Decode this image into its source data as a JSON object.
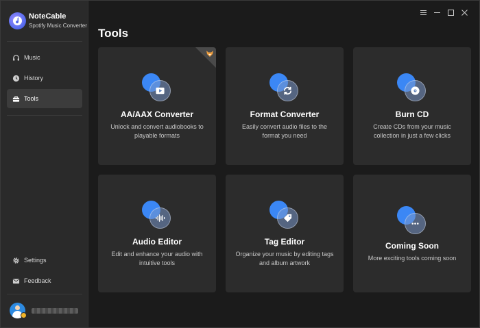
{
  "app": {
    "name": "NoteCable",
    "subtitle": "Spotify Music Converter"
  },
  "sidebar": {
    "items": [
      {
        "label": "Music",
        "icon": "headphones-icon",
        "active": false
      },
      {
        "label": "History",
        "icon": "clock-icon",
        "active": false
      },
      {
        "label": "Tools",
        "icon": "toolbox-icon",
        "active": true
      }
    ],
    "bottom_items": [
      {
        "label": "Settings",
        "icon": "gear-icon"
      },
      {
        "label": "Feedback",
        "icon": "mail-icon"
      }
    ]
  },
  "page": {
    "title": "Tools"
  },
  "tools": [
    {
      "title": "AA/AAX Converter",
      "description": "Unlock and convert audiobooks to playable formats",
      "icon": "play-icon",
      "badge": "fox-icon"
    },
    {
      "title": "Format Converter",
      "description": "Easily convert audio files to the format you need",
      "icon": "refresh-icon"
    },
    {
      "title": "Burn CD",
      "description": "Create CDs from your music collection in just a few clicks",
      "icon": "disc-icon"
    },
    {
      "title": "Audio Editor",
      "description": "Edit and enhance your audio with intuitive tools",
      "icon": "waveform-icon"
    },
    {
      "title": "Tag Editor",
      "description": "Organize your music by editing tags and album artwork",
      "icon": "tag-icon"
    },
    {
      "title": "Coming Soon",
      "description": "More exciting tools coming soon",
      "icon": "ellipsis-icon"
    }
  ],
  "colors": {
    "accent": "#3b87f5",
    "sidebar_bg": "#2a2a2a",
    "card_bg": "#2c2c2c",
    "page_bg": "#1b1b1b"
  }
}
